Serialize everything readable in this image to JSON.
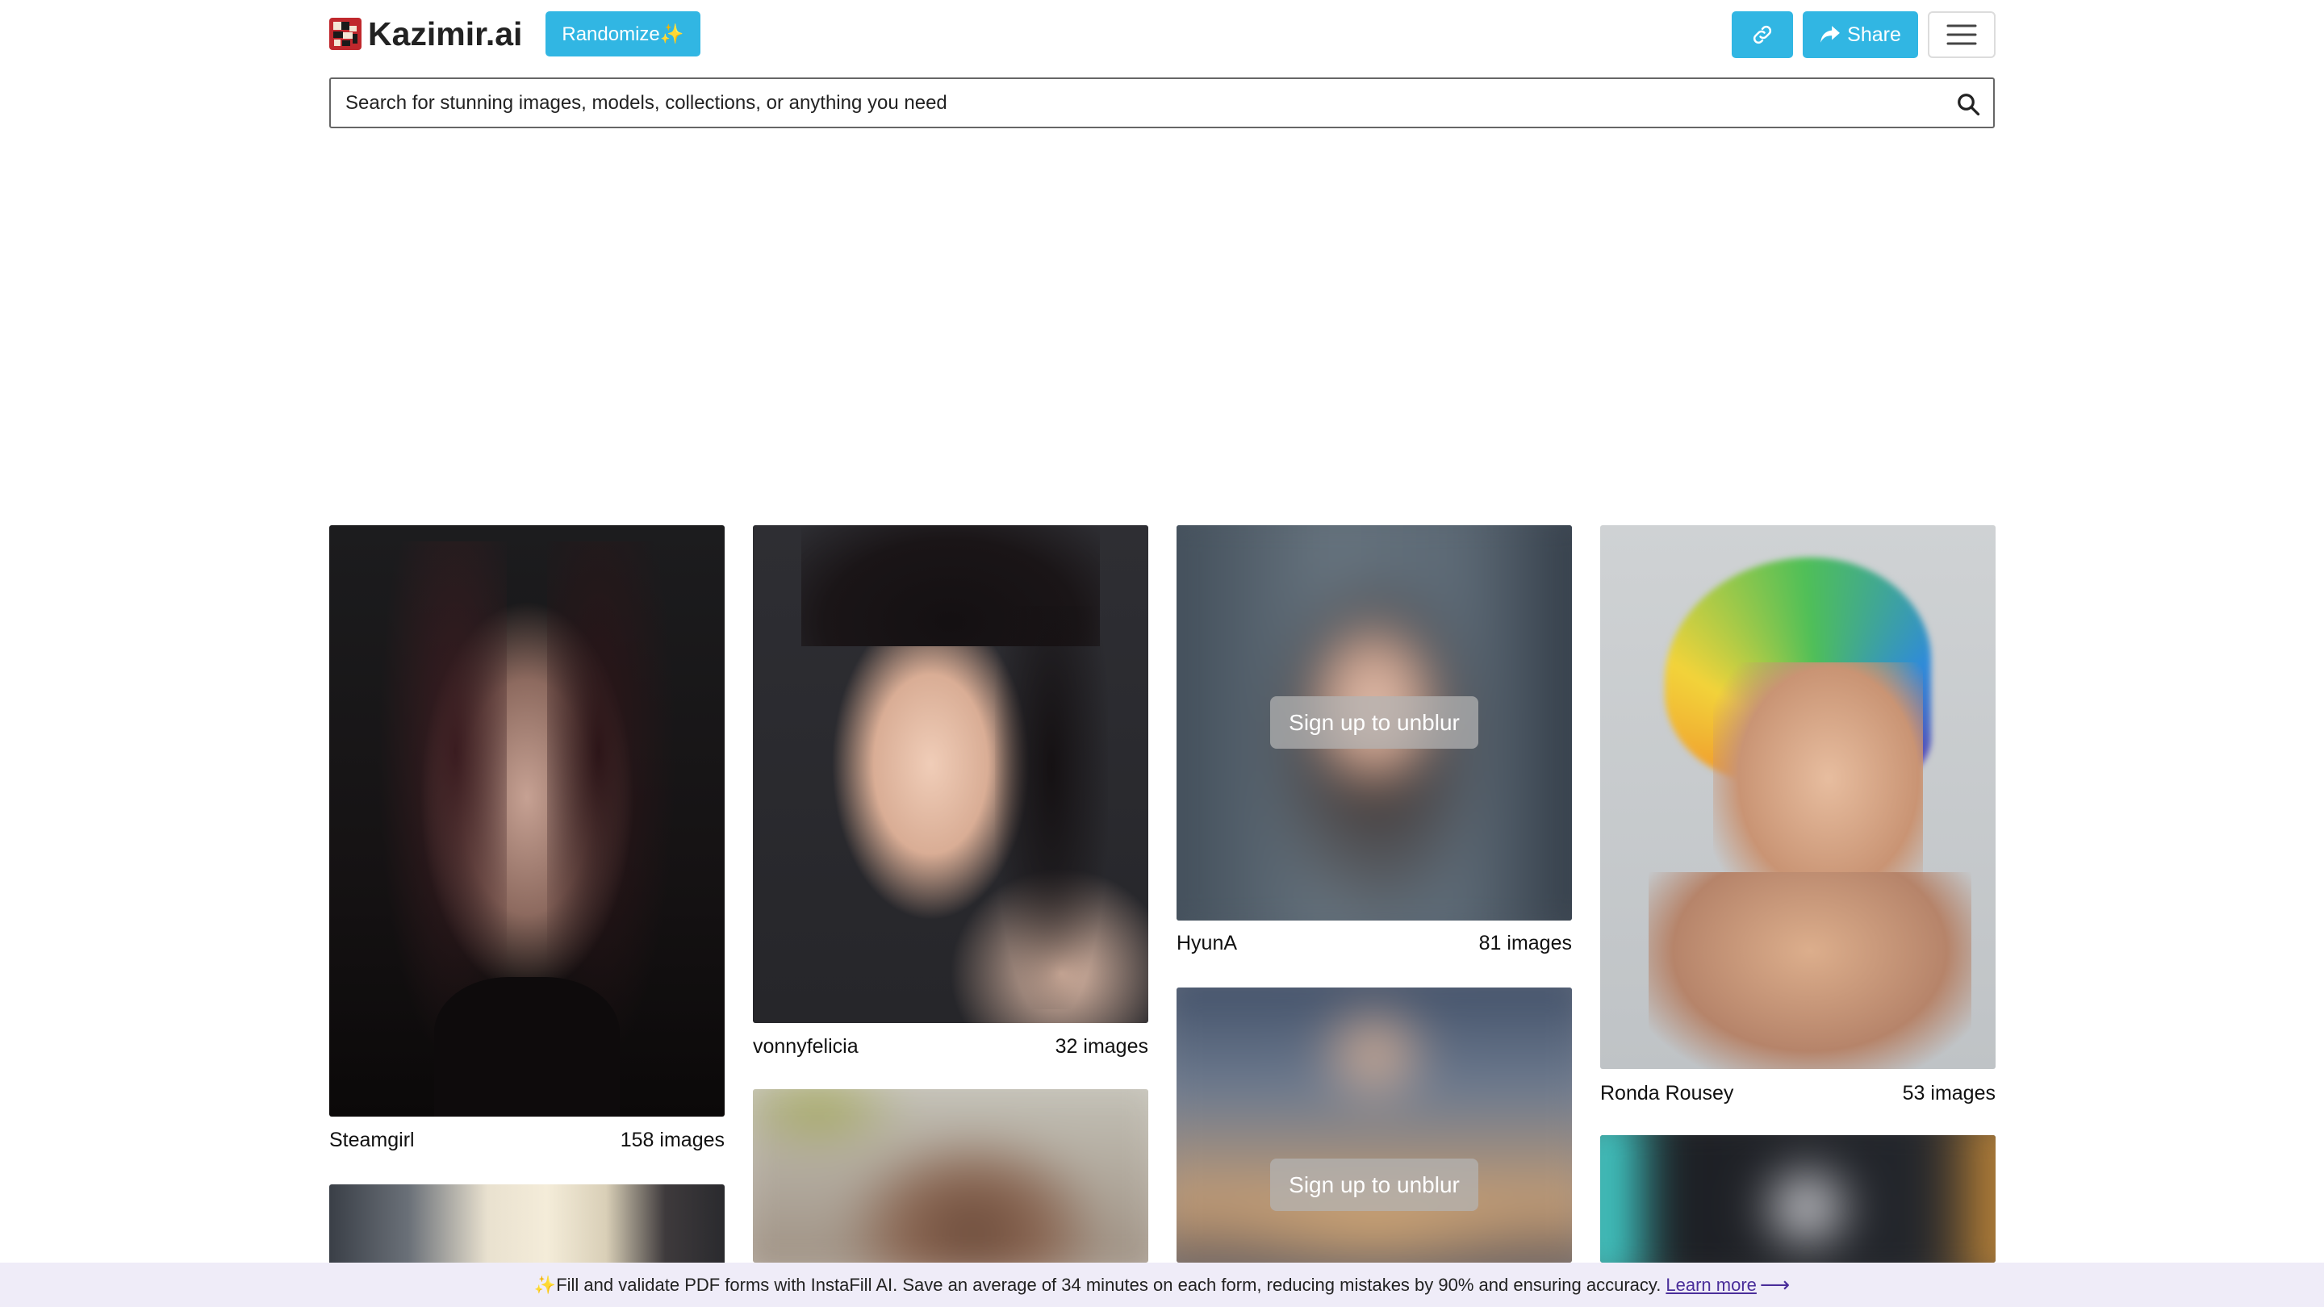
{
  "brand": {
    "name": "Kazimir.ai"
  },
  "header": {
    "randomize_label": "Randomize✨",
    "share_label": "Share",
    "accent_color": "#31b6e3"
  },
  "search": {
    "placeholder": "Search for stunning images, models, collections, or anything you need"
  },
  "cards": [
    {
      "name": "Steamgirl",
      "count": "158 images",
      "blurred": false
    },
    {
      "name": "vonnyfelicia",
      "count": "32 images",
      "blurred": false
    },
    {
      "name": "HyunA",
      "count": "81 images",
      "blurred": true,
      "unblur_label": "Sign up to unblur"
    },
    {
      "name": "Ronda Rousey",
      "count": "53 images",
      "blurred": false
    },
    {
      "name": "",
      "count": "",
      "blurred": true,
      "unblur_label": "Sign up to unblur"
    }
  ],
  "banner": {
    "text": "✨Fill and validate PDF forms with InstaFill AI. Save an average of 34 minutes on each form, reducing mistakes by 90% and ensuring accuracy.",
    "link_label": "Learn more",
    "arrow": "⟶"
  }
}
